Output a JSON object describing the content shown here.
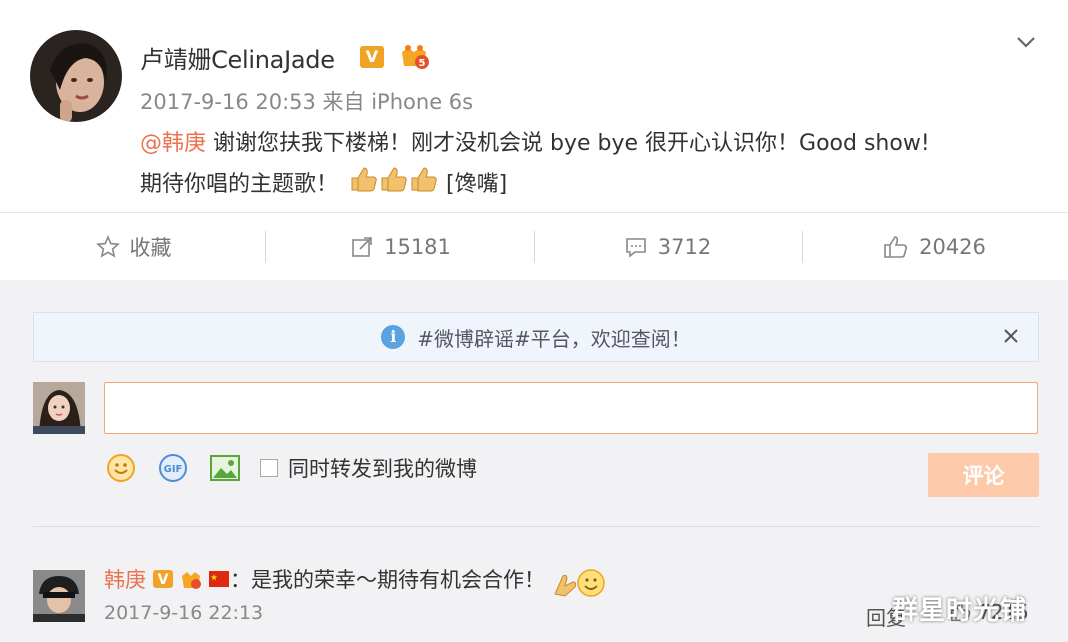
{
  "post": {
    "username": "卢靖姗CelinaJade",
    "meta": "2017-9-16 20:53 来自 iPhone 6s",
    "mention": "@韩庚",
    "content_line1": " 谢谢您扶我下楼梯！刚才没机会说 bye bye 很开心认识你！Good show!",
    "content_line2": "期待你唱的主题歌！",
    "emoji_text": "[馋嘴]",
    "verified_badge": "V"
  },
  "actions": {
    "favorite": "收藏",
    "repost": "15181",
    "comment": "3712",
    "like": "20426"
  },
  "comment_box": {
    "notice": "#微博辟谣#平台，欢迎查阅！",
    "input_placeholder": "",
    "forward_label": "同时转发到我的微博",
    "submit": "评论"
  },
  "reply": {
    "name": "韩庚",
    "text": "：是我的荣幸～期待有机会合作！",
    "time": "2017-9-16 22:13",
    "reply_label": "回复",
    "like_count": "7215"
  },
  "watermark": "群星时光铺",
  "colors": {
    "accent": "#eb7350",
    "submit_disabled": "#fcc9a9",
    "badge_gold": "#f0a324"
  }
}
